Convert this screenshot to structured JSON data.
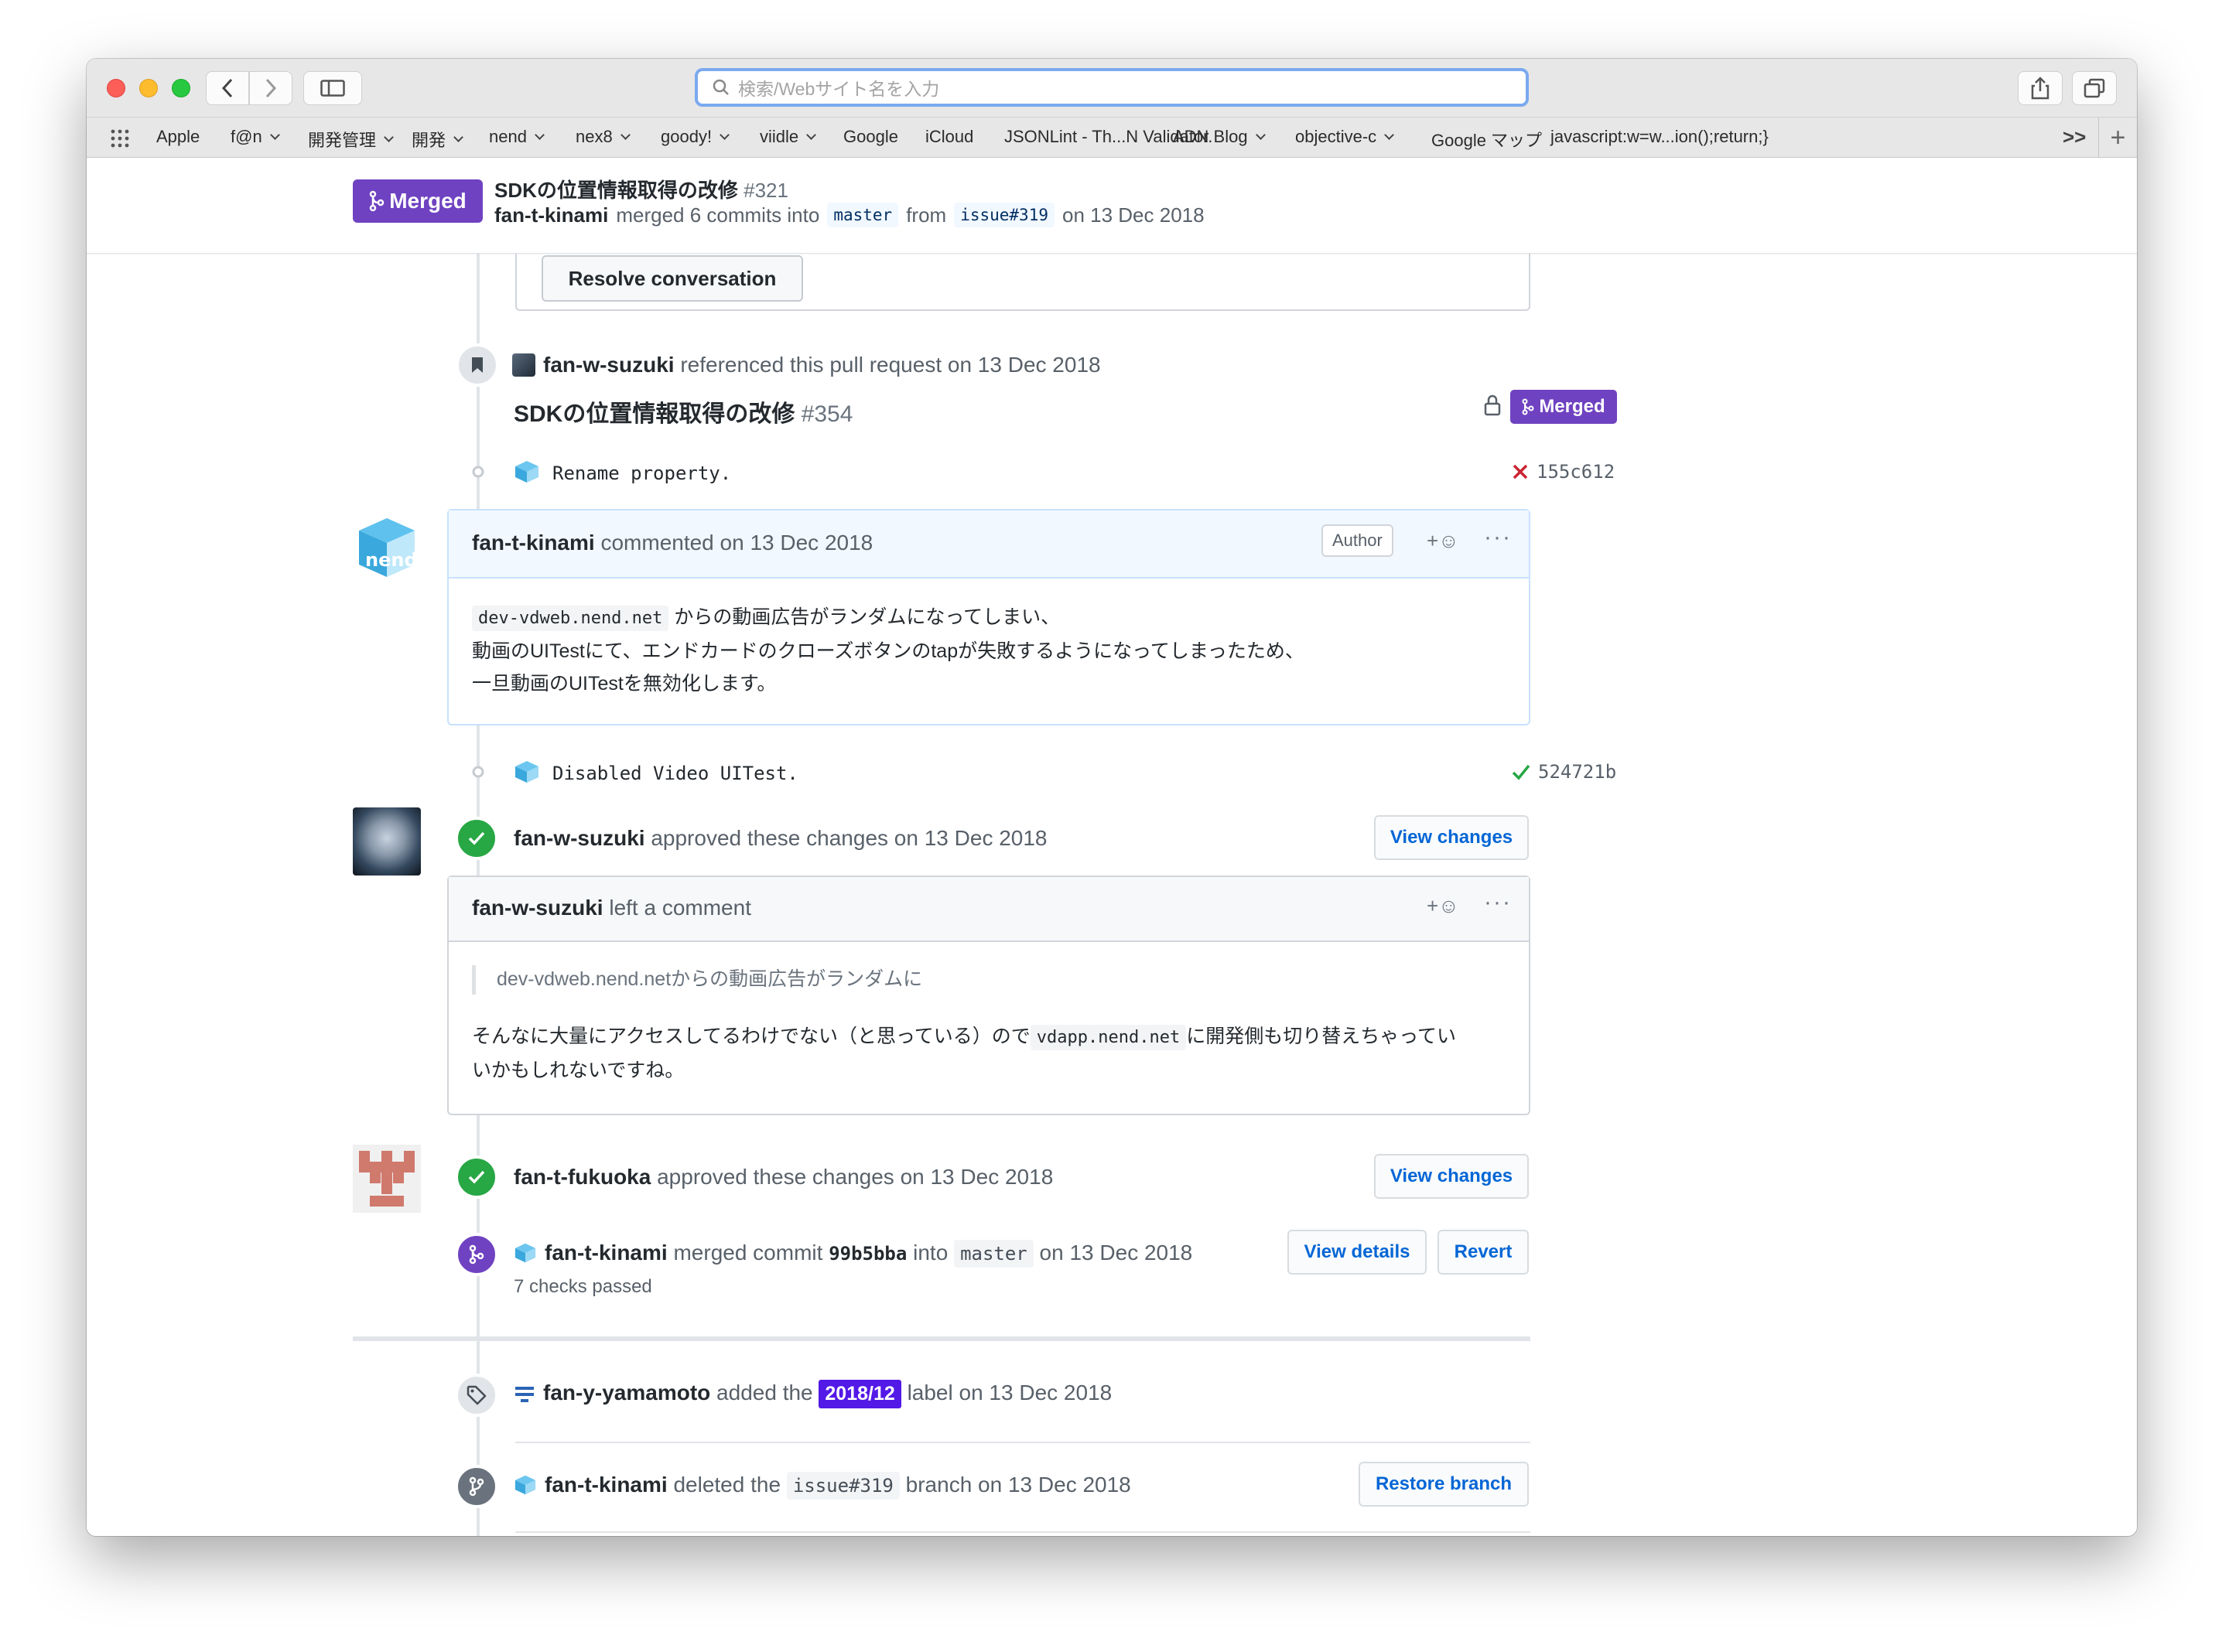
{
  "browser": {
    "address_placeholder": "検索/Webサイト名を入力",
    "bookmarks": [
      {
        "label": "Apple",
        "menu": false
      },
      {
        "label": "f@n",
        "menu": true
      },
      {
        "label": "開発管理",
        "menu": true
      },
      {
        "label": "開発",
        "menu": true
      },
      {
        "label": "nend",
        "menu": true
      },
      {
        "label": "nex8",
        "menu": true
      },
      {
        "label": "goody!",
        "menu": true
      },
      {
        "label": "viidle",
        "menu": true
      },
      {
        "label": "Google",
        "menu": false
      },
      {
        "label": "iCloud",
        "menu": false
      },
      {
        "label": "JSONLint - Th...N Validator.",
        "menu": false
      },
      {
        "label": "ADN Blog",
        "menu": true
      },
      {
        "label": "objective-c",
        "menu": true
      },
      {
        "label": "Google マップ",
        "menu": false
      },
      {
        "label": "javascript:w=w...ion();return;}",
        "menu": false
      }
    ],
    "overflow": ">>",
    "new_tab": "+"
  },
  "header": {
    "state": "Merged",
    "title": "SDKの位置情報取得の改修",
    "number": "#321",
    "author": "fan-t-kinami",
    "merged_text": "merged 6 commits into",
    "base": "master",
    "from_text": "from",
    "head": "issue#319",
    "date_text": "on 13 Dec 2018"
  },
  "resolve_button": "Resolve conversation",
  "reference": {
    "user": "fan-w-suzuki",
    "text": "referenced this pull request on 13 Dec 2018",
    "pr_title": "SDKの位置情報取得の改修",
    "pr_number": "#354",
    "pr_state": "Merged"
  },
  "commit1": {
    "message": "Rename property.",
    "sha": "155c612",
    "status": "failed"
  },
  "comment1": {
    "user": "fan-t-kinami",
    "meta": "commented on 13 Dec 2018",
    "role": "Author",
    "line1_code": "dev-vdweb.nend.net",
    "line1_text": "からの動画広告がランダムになってしまい、",
    "line2": "動画のUITestにて、エンドカードのクローズボタンのtapが失敗するようになってしまったため、",
    "line3": "一旦動画のUITestを無効化します。"
  },
  "commit2": {
    "message": "Disabled Video UITest.",
    "sha": "524721b",
    "status": "passed"
  },
  "review1": {
    "user": "fan-w-suzuki",
    "text": "approved these changes on 13 Dec 2018",
    "button": "View changes"
  },
  "comment2": {
    "user": "fan-w-suzuki",
    "meta": "left a comment",
    "quote": "dev-vdweb.nend.netからの動画広告がランダムに",
    "line1_pre": "そんなに大量にアクセスしてるわけでない（と思っている）ので",
    "line1_code": "vdapp.nend.net",
    "line1_post": "に開発側も切り替えちゃってい",
    "line2": "いかもしれないですね。"
  },
  "review2": {
    "user": "fan-t-fukuoka",
    "text": "approved these changes on 13 Dec 2018",
    "button": "View changes"
  },
  "merge": {
    "user": "fan-t-kinami",
    "text1": "merged commit",
    "sha": "99b5bba",
    "text2": "into",
    "branch": "master",
    "text3": "on 13 Dec 2018",
    "checks": "7 checks passed",
    "details_button": "View details",
    "revert_button": "Revert"
  },
  "label_event": {
    "user": "fan-y-yamamoto",
    "text1": "added the",
    "label": "2018/12",
    "text2": "label on 13 Dec 2018",
    "label_color": "#5319e7"
  },
  "delete_event": {
    "user": "fan-t-kinami",
    "text1": "deleted the",
    "branch": "issue#319",
    "text2": "branch on 13 Dec 2018",
    "button": "Restore branch"
  },
  "icons": {
    "emoji_add": "+☺",
    "more": "···"
  },
  "colors": {
    "merged": "#6f42c1",
    "approved": "#28a745",
    "link": "#0366d6",
    "fail": "#cb2431"
  }
}
